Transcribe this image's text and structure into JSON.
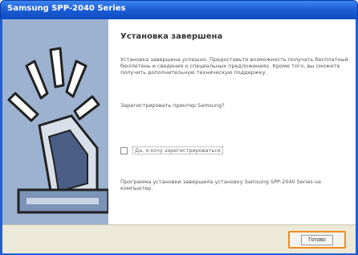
{
  "window": {
    "title": "Samsung SPP-2040 Series"
  },
  "main": {
    "heading": "Установка завершена",
    "body": "Установка завершена успешно. Предоставьте возможность получать бесплатный бюллетень и сведения о специальных предложениях. Кроме того, вы сможете получить дополнительную техническую поддержку.",
    "question": "Зарегистрировать принтер Samsung?",
    "checkbox_label": "Да, я хочу зарегистрироваться",
    "footer": "Программа установки завершила установку Samsung SPP-2040 Series на компьютер."
  },
  "buttons": {
    "finish_label": "Готово"
  },
  "colors": {
    "titlebar": "#1e5fd6",
    "highlight": "#f08c1e",
    "art_background": "#8fa7c8"
  },
  "icons": {
    "printer": "printer-illustration"
  }
}
